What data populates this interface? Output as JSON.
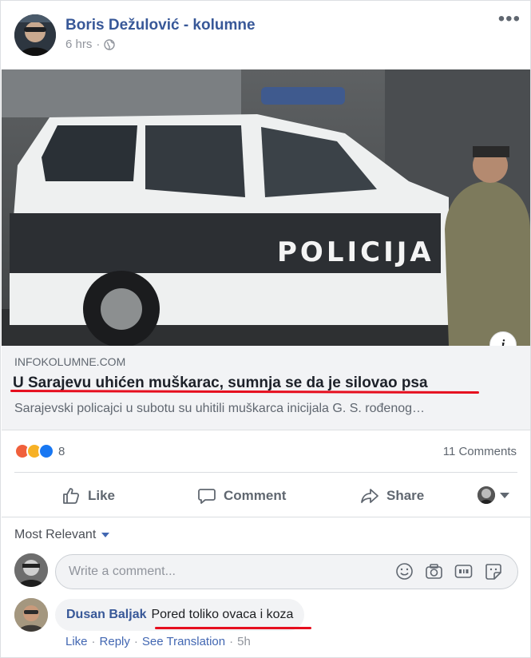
{
  "post": {
    "author": "Boris Dežulović - kolumne",
    "time": "6 hrs",
    "separator": "·",
    "more_glyph": "•••"
  },
  "link": {
    "domain": "INFOKOLUMNE.COM",
    "title": "U Sarajevu uhićen muškarac, sumnja se da je silovao psa",
    "description": "Sarajevski policajci u subotu su uhitili muškarca inicijala G. S. rođenog…",
    "image_text": "POLICIJA",
    "info_glyph": "i"
  },
  "stats": {
    "reactions": [
      {
        "type": "angry",
        "icon": "angry-reaction-icon",
        "color": "#f0603c"
      },
      {
        "type": "haha",
        "icon": "haha-reaction-icon",
        "color": "#f7b125"
      },
      {
        "type": "like",
        "icon": "like-reaction-icon",
        "color": "#1877f2"
      }
    ],
    "reaction_count": "8",
    "comment_count": "11 Comments"
  },
  "actions": {
    "like": "Like",
    "comment": "Comment",
    "share": "Share"
  },
  "comments_section": {
    "sort_label": "Most Relevant",
    "input_placeholder": "Write a comment...",
    "items": [
      {
        "author": "Dusan Baljak",
        "text": "Pored toliko ovaca i koza",
        "like": "Like",
        "reply": "Reply",
        "see_translation": "See Translation",
        "time": "5h",
        "separator": "·"
      }
    ]
  },
  "colors": {
    "link_blue": "#385898",
    "annotation_red": "#e60e1e",
    "muted": "#606770"
  }
}
